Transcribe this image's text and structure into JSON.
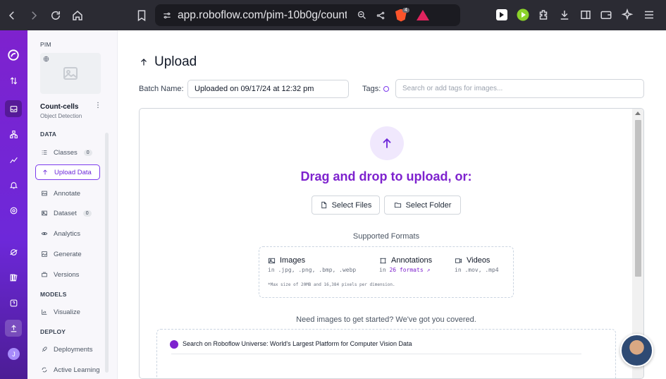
{
  "browser": {
    "url": "app.roboflow.com/pim-10b0g/count...",
    "brave_count": "4"
  },
  "sidebar": {
    "workspace": "PIM",
    "project_name": "Count-cells",
    "project_type": "Object Detection",
    "sections": {
      "data": "DATA",
      "models": "MODELS",
      "deploy": "DEPLOY"
    },
    "items": [
      {
        "label": "Classes",
        "badge": "0"
      },
      {
        "label": "Upload Data"
      },
      {
        "label": "Annotate"
      },
      {
        "label": "Dataset",
        "badge": "0"
      },
      {
        "label": "Analytics"
      },
      {
        "label": "Generate"
      },
      {
        "label": "Versions"
      },
      {
        "label": "Visualize"
      },
      {
        "label": "Deployments"
      },
      {
        "label": "Active Learning"
      }
    ]
  },
  "main": {
    "title": "Upload",
    "batch_label": "Batch Name:",
    "batch_value": "Uploaded on 09/17/24 at 12:32 pm",
    "tags_label": "Tags:",
    "tags_placeholder": "Search or add tags for images...",
    "drag_text": "Drag and drop to upload, or:",
    "select_files": "Select Files",
    "select_folder": "Select Folder",
    "formats_title": "Supported Formats",
    "formats": {
      "images_title": "Images",
      "images_list": "in .jpg, .png, .bmp, .webp",
      "annotations_title": "Annotations",
      "annotations_prefix": "in",
      "annotations_link": "26 formats",
      "videos_title": "Videos",
      "videos_list": "in .mov, .mp4",
      "note": "*Max size of 20MB and 16,384 pixels per dimension."
    },
    "need_text": "Need images to get started? We've got you covered.",
    "universe_text": "Search on Roboflow Universe: World's Largest Platform for Computer Vision Data"
  },
  "user_initial": "J"
}
